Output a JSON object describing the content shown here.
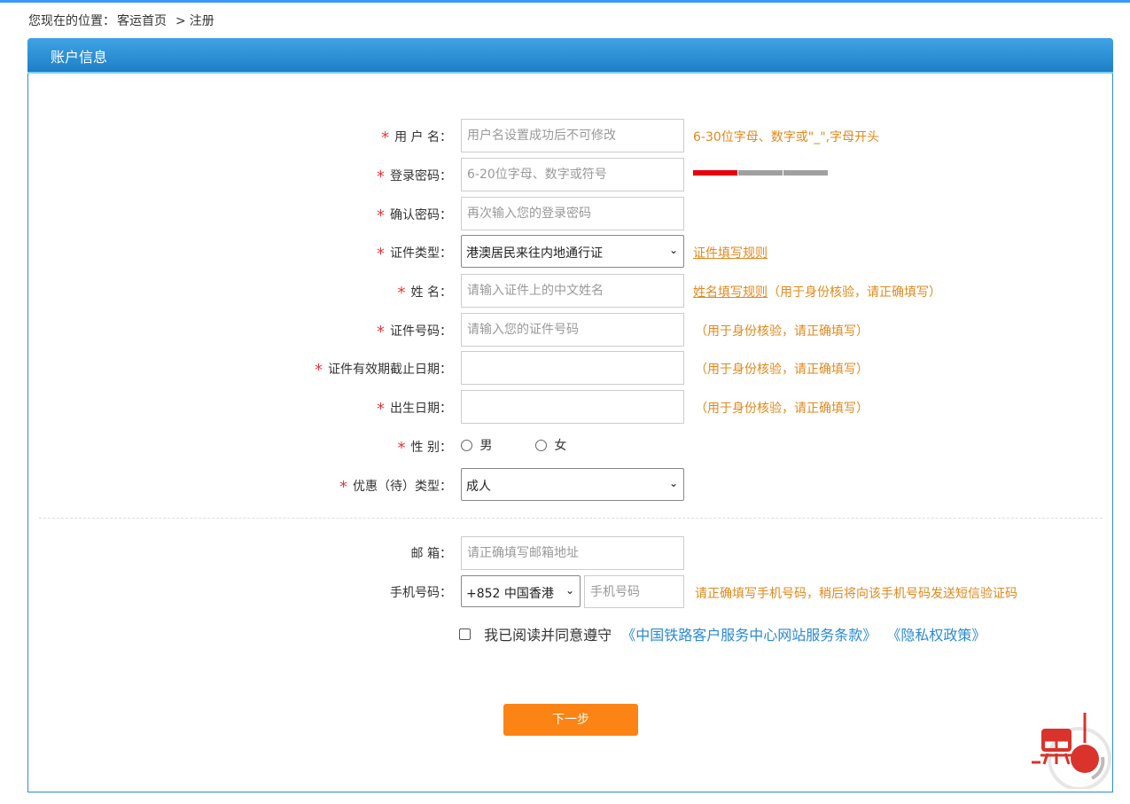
{
  "breadcrumb": {
    "prefix": "您现在的位置：",
    "home": "客运首页",
    "separator": ">",
    "current": "注册"
  },
  "panel": {
    "title": "账户信息"
  },
  "fields": {
    "username": {
      "label": "用 户 名：",
      "placeholder": "用户名设置成功后不可修改",
      "hint": "6-30位字母、数字或\"_\",字母开头"
    },
    "password": {
      "label": "登录密码：",
      "placeholder": "6-20位字母、数字或符号"
    },
    "confirm": {
      "label": "确认密码：",
      "placeholder": "再次输入您的登录密码"
    },
    "id_type": {
      "label": "证件类型：",
      "value": "港澳居民来往内地通行证",
      "rule_link": "证件填写规则"
    },
    "name": {
      "label": "姓 名：",
      "placeholder": "请输入证件上的中文姓名",
      "rule_link": "姓名填写规则",
      "hint": "（用于身份核验，请正确填写）"
    },
    "id_number": {
      "label": "证件号码：",
      "placeholder": "请输入您的证件号码",
      "hint": "（用于身份核验，请正确填写）"
    },
    "expiry": {
      "label": "证件有效期截止日期：",
      "hint": "（用于身份核验，请正确填写）"
    },
    "birth": {
      "label": "出生日期：",
      "hint": "（用于身份核验，请正确填写）"
    },
    "gender": {
      "label": "性 别：",
      "options": [
        "男",
        "女"
      ]
    },
    "discount": {
      "label": "优惠（待）类型：",
      "value": "成人"
    },
    "email": {
      "label": "邮 箱：",
      "placeholder": "请正确填写邮箱地址"
    },
    "phone": {
      "label": "手机号码：",
      "country": "+852 中国香港",
      "placeholder": "手机号码",
      "hint": "请正确填写手机号码，稍后将向该手机号码发送短信验证码"
    }
  },
  "required_mark": "*",
  "agreement": {
    "text": "我已阅读并同意遵守",
    "terms_link": "《中国铁路客户服务中心网站服务条款》",
    "privacy_link": "《隐私权政策》"
  },
  "next_button": "下一步",
  "colors": {
    "accent": "#fb8414",
    "header": "#1e7fc7",
    "hint": "#e0891c",
    "required": "#e4393c",
    "link": "#2a8ad1"
  }
}
